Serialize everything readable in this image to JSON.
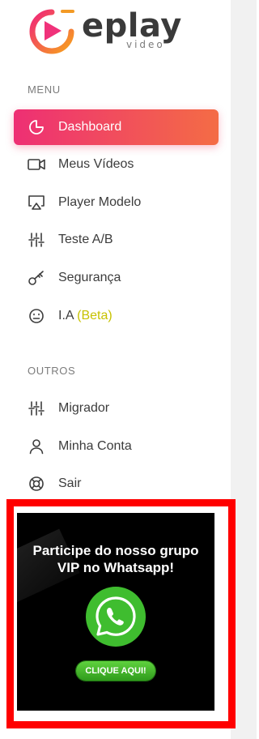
{
  "brand": {
    "name": "eplay",
    "sub": "video"
  },
  "menu": {
    "heading": "MENU",
    "items": [
      {
        "label": "Dashboard",
        "icon": "pie-chart-icon",
        "active": true
      },
      {
        "label": "Meus Vídeos",
        "icon": "video-camera-icon"
      },
      {
        "label": "Player Modelo",
        "icon": "airplay-icon"
      },
      {
        "label": "Teste A/B",
        "icon": "sliders-icon"
      },
      {
        "label": "Segurança",
        "icon": "key-icon"
      },
      {
        "label": "I.A",
        "badge": "(Beta)",
        "icon": "smiley-icon"
      }
    ]
  },
  "outros": {
    "heading": "OUTROS",
    "items": [
      {
        "label": "Migrador",
        "icon": "sliders-icon"
      },
      {
        "label": "Minha Conta",
        "icon": "user-icon"
      },
      {
        "label": "Sair",
        "icon": "lifebuoy-icon"
      }
    ]
  },
  "promo": {
    "title_line1": "Participe do nosso grupo",
    "title_line2": "VIP no Whatsapp!",
    "cta": "CLIQUE AQUI!",
    "icon": "whatsapp-icon"
  },
  "colors": {
    "accent_start": "#ee2f74",
    "accent_end": "#f46c45",
    "beta": "#c7c200",
    "highlight_border": "#ff0000",
    "whatsapp": "#3fbd2f"
  }
}
